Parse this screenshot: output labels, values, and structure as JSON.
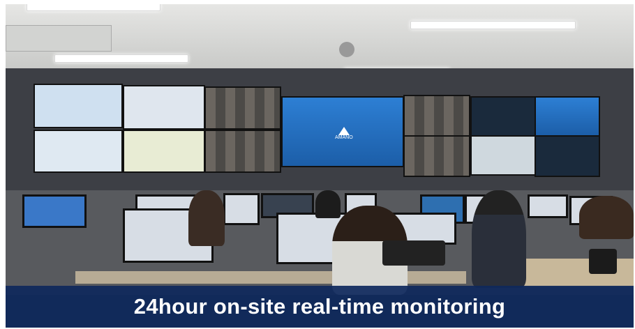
{
  "caption": {
    "text": "24hour on-site real-time monitoring"
  },
  "logo": {
    "text": "AMANO"
  },
  "colors": {
    "caption_bg": "#0e285c",
    "caption_text": "#ffffff",
    "main_screen": "#1c5ea8"
  }
}
